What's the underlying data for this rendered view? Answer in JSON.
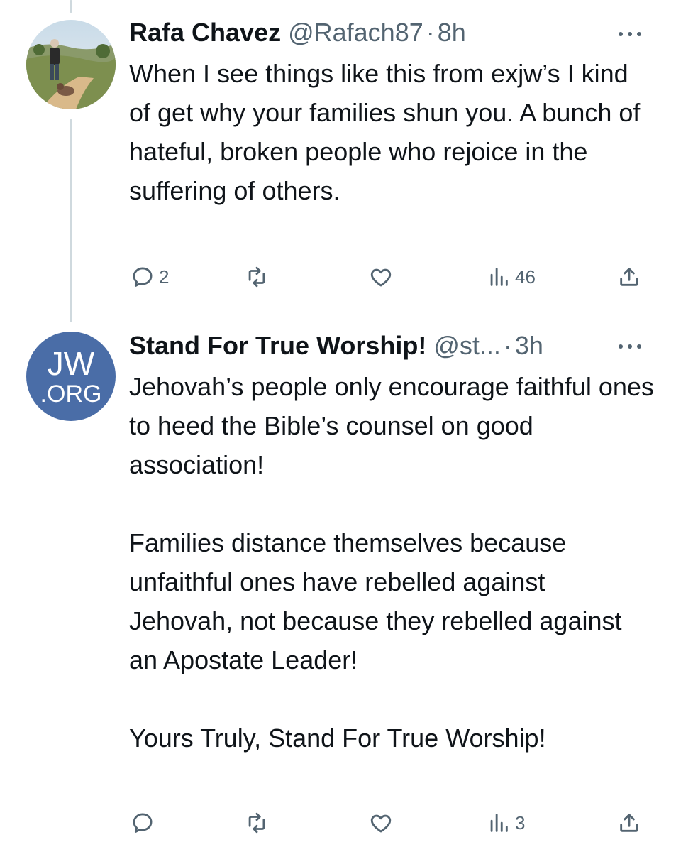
{
  "tweets": [
    {
      "author": "Rafa Chavez",
      "handle": "@Rafach87",
      "separator": "·",
      "time": "8h",
      "text": "When I see things like this from exjw’s I kind of get why your families shun you. A bunch of hateful, broken people who rejoice in the suffering of others.",
      "replies": "2",
      "retweets": "",
      "likes": "",
      "views": "46"
    },
    {
      "author": "Stand For True Worship!",
      "handle": "@st...",
      "separator": "·",
      "time": "3h",
      "avatar_line1": "JW",
      "avatar_line2": ".ORG",
      "text": "Jehovah’s people only encourage faithful ones to heed the Bible’s counsel on good association!\n\nFamilies distance themselves because unfaithful ones have rebelled against Jehovah, not because they rebelled against an Apostate Leader!\n\nYours Truly, Stand For True Worship!",
      "replies": "",
      "retweets": "",
      "likes": "",
      "views": "3"
    }
  ],
  "icons": {
    "reply": "reply-icon",
    "retweet": "retweet-icon",
    "like": "heart-icon",
    "views": "views-icon",
    "share": "share-icon",
    "more": "more-icon"
  },
  "colors": {
    "text": "#0f1419",
    "secondary": "#536471",
    "thread_line": "#cfd9de",
    "jw_blue": "#4a6da7"
  }
}
